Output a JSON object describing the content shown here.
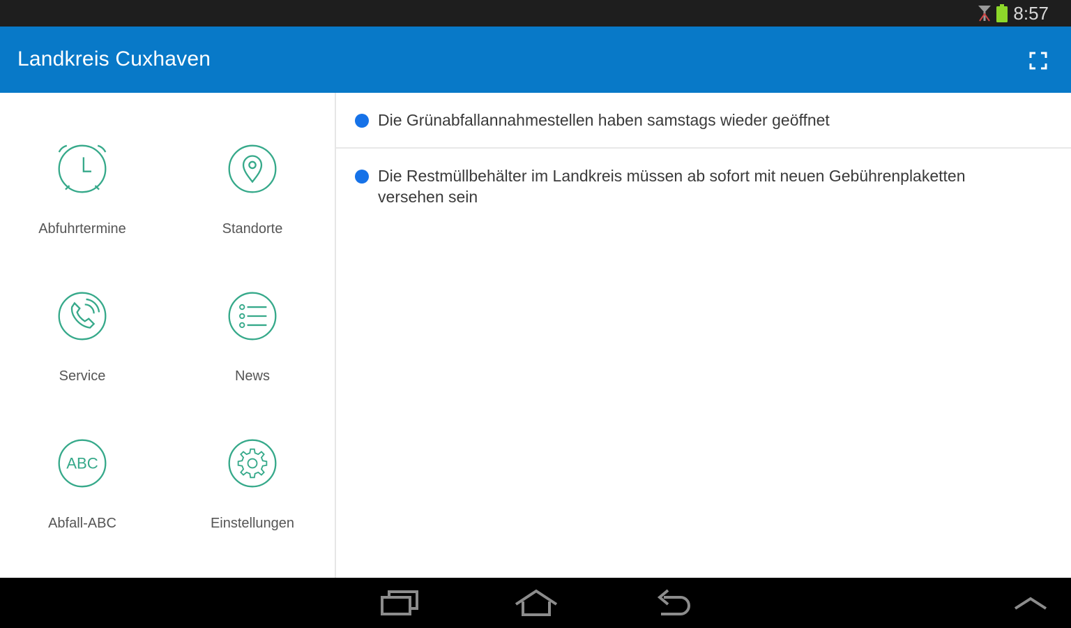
{
  "status_bar": {
    "time": "8:57",
    "icons": [
      "signal-icon",
      "battery-icon"
    ],
    "battery_color": "#8dd82a"
  },
  "app_bar": {
    "title": "Landkreis Cuxhaven",
    "action_icon": "fullscreen-icon",
    "background": "#0879c8"
  },
  "menu": {
    "accent_color": "#36a98a",
    "tiles": [
      {
        "label": "Abfuhrtermine",
        "icon": "alarm-clock-icon"
      },
      {
        "label": "Standorte",
        "icon": "location-pin-icon"
      },
      {
        "label": "Service",
        "icon": "phone-icon"
      },
      {
        "label": "News",
        "icon": "list-icon"
      },
      {
        "label": "Abfall-ABC",
        "icon": "abc-icon",
        "icon_text": "ABC"
      },
      {
        "label": "Einstellungen",
        "icon": "gear-icon"
      }
    ]
  },
  "news": {
    "dot_color": "#1672e8",
    "items": [
      {
        "text": "Die Grünabfallannahmestellen haben samstags wieder geöffnet"
      },
      {
        "text": "Die Restmüllbehälter im Landkreis müssen ab sofort mit neuen Gebührenplaketten versehen sein"
      }
    ]
  },
  "nav_bar": {
    "buttons": [
      "recent-apps-icon",
      "home-icon",
      "back-icon",
      "chevron-up-icon"
    ]
  }
}
